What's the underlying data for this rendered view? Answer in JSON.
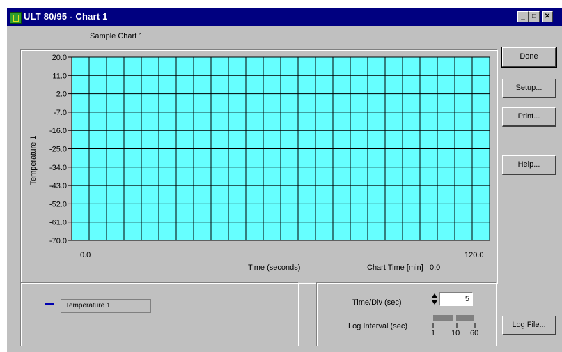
{
  "window": {
    "title": "ULT 80/95 - Chart 1",
    "controls": {
      "minimize": "_",
      "maximize": "□",
      "close": "✕"
    }
  },
  "chart_title": "Sample Chart 1",
  "chart_data": {
    "type": "line",
    "title": "Sample Chart 1",
    "ylabel": "Temperature 1",
    "xlabel": "Time (seconds)",
    "yticks": [
      "20.0",
      "11.0",
      "2.0",
      "-7.0",
      "-16.0",
      "-25.0",
      "-34.0",
      "-43.0",
      "-52.0",
      "-61.0",
      "-70.0"
    ],
    "ylim": [
      -70.0,
      20.0
    ],
    "xlim": [
      0.0,
      120.0
    ],
    "x_start_label": "0.0",
    "x_end_label": "120.0",
    "x_divisions": 24,
    "grid": true,
    "plot_background": "#66ffff",
    "series": [
      {
        "name": "Temperature 1",
        "color": "#0000b0",
        "values": []
      }
    ]
  },
  "chart_time": {
    "label": "Chart Time [min]",
    "value": "0.0"
  },
  "buttons": {
    "done": "Done",
    "setup": "Setup...",
    "print": "Print...",
    "help": "Help...",
    "log_file": "Log File..."
  },
  "legend": {
    "items": [
      {
        "label": "Temperature 1",
        "color": "#0000b0"
      }
    ]
  },
  "controls": {
    "time_div_label": "Time/Div (sec)",
    "time_div_value": "5",
    "log_interval_label": "Log Interval (sec)",
    "log_interval_ticks": [
      "1",
      "10",
      "60"
    ]
  }
}
